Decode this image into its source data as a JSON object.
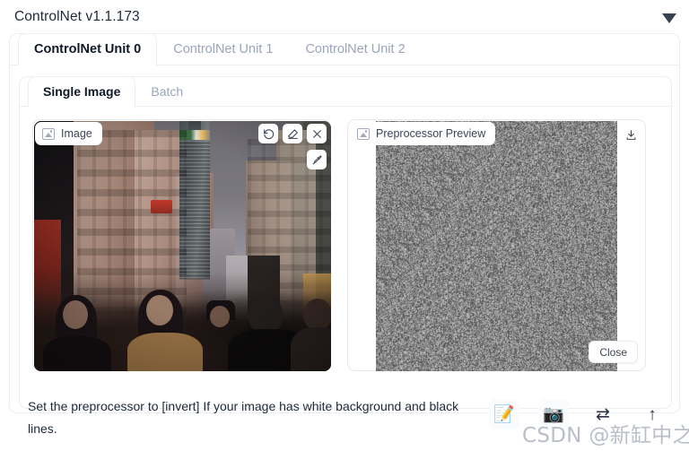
{
  "accordion": {
    "title": "ControlNet v1.1.173",
    "collapse_icon": "triangle-down-icon"
  },
  "unit_tabs": [
    {
      "label": "ControlNet Unit 0",
      "active": true
    },
    {
      "label": "ControlNet Unit 1",
      "active": false
    },
    {
      "label": "ControlNet Unit 2",
      "active": false
    }
  ],
  "mode_tabs": [
    {
      "label": "Single Image",
      "active": true
    },
    {
      "label": "Batch",
      "active": false
    }
  ],
  "image_panel": {
    "badge_label": "Image",
    "badge_icon": "image-placeholder-icon",
    "tools": [
      {
        "name": "undo-icon",
        "title": "Undo"
      },
      {
        "name": "eraser-icon",
        "title": "Erase"
      },
      {
        "name": "close-icon",
        "title": "Remove"
      }
    ],
    "secondary_tool": {
      "name": "pen-brush-icon",
      "title": "Draw"
    }
  },
  "preview_panel": {
    "badge_label": "Preprocessor Preview",
    "badge_icon": "image-placeholder-icon",
    "download_icon": "download-icon",
    "close_label": "Close"
  },
  "footer": {
    "hint": "Set the preprocessor to [invert] If your image has white background and black lines.",
    "actions": [
      {
        "name": "memo-pencil-icon",
        "glyph": "📝"
      },
      {
        "name": "camera-icon",
        "glyph": "📷"
      },
      {
        "name": "swap-arrows-icon",
        "glyph": "⇄"
      },
      {
        "name": "upload-arrow-icon",
        "glyph": "↑"
      }
    ]
  },
  "watermark": "CSDN @新缸中之脑",
  "colors": {
    "text_primary": "#1f2937",
    "text_muted": "#9ca4bb",
    "border": "#eceef3",
    "surface": "#ffffff"
  }
}
